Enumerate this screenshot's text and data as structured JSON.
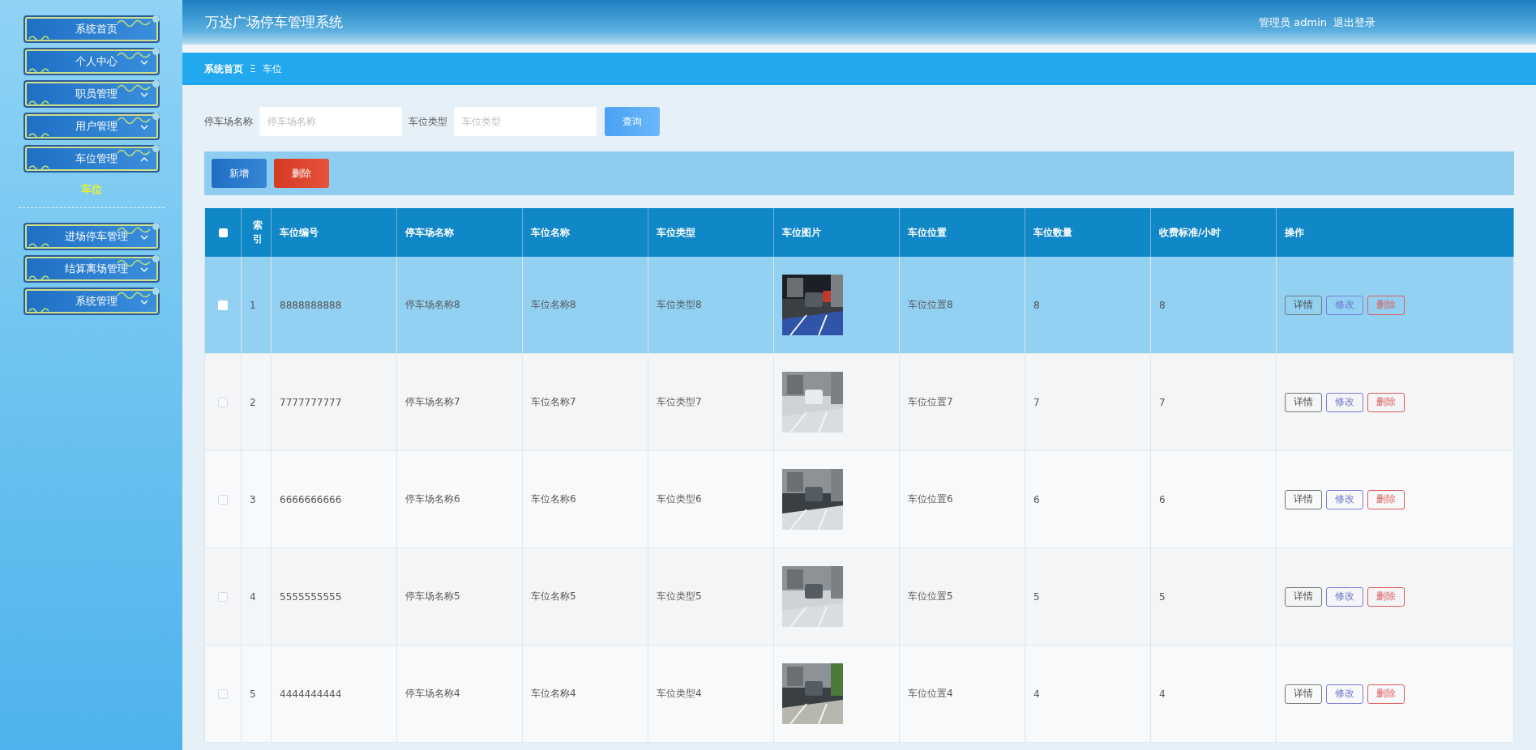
{
  "sidebar": {
    "items": [
      {
        "label": "系统首页",
        "kind": "link"
      },
      {
        "label": "个人中心",
        "kind": "group",
        "expanded": false
      },
      {
        "label": "职员管理",
        "kind": "group",
        "expanded": false
      },
      {
        "label": "用户管理",
        "kind": "group",
        "expanded": false
      },
      {
        "label": "车位管理",
        "kind": "group",
        "expanded": true,
        "children": [
          {
            "label": "车位",
            "selected": true
          }
        ]
      },
      {
        "label": "进场停车管理",
        "kind": "group",
        "expanded": false
      },
      {
        "label": "结算离场管理",
        "kind": "group",
        "expanded": false
      },
      {
        "label": "系统管理",
        "kind": "group",
        "expanded": false
      }
    ]
  },
  "header": {
    "title": "万达广场停车管理系统",
    "user": "管理员 admin",
    "logout": "退出登录"
  },
  "breadcrumb": {
    "items": [
      "系统首页",
      "车位"
    ],
    "separator": "Ξ"
  },
  "search": {
    "fields": [
      {
        "label": "停车场名称",
        "placeholder": "停车场名称"
      },
      {
        "label": "车位类型",
        "placeholder": "车位类型"
      }
    ],
    "button": "查询"
  },
  "toolbar": {
    "buttons": [
      {
        "label": "新增",
        "kind": "add"
      },
      {
        "label": "删除",
        "kind": "delete"
      }
    ]
  },
  "table": {
    "select_all": {
      "checked": false
    },
    "columns": [
      "索引",
      "车位编号",
      "停车场名称",
      "车位名称",
      "车位类型",
      "车位图片",
      "车位位置",
      "车位数量",
      "收费标准/小时",
      "操作"
    ],
    "rows": [
      {
        "index": "1",
        "code": "8888888888",
        "lot": "停车场名称8",
        "name": "车位名称8",
        "type": "车位类型8",
        "position": "车位位置8",
        "count": "8",
        "fee": "8",
        "selected": true,
        "checked": false,
        "actions": [
          {
            "label": "详情",
            "kind": "detail"
          },
          {
            "label": "修改",
            "kind": "edit"
          },
          {
            "label": "删除",
            "kind": "delete"
          }
        ]
      },
      {
        "index": "2",
        "code": "7777777777",
        "lot": "停车场名称7",
        "name": "车位名称7",
        "type": "车位类型7",
        "position": "车位位置7",
        "count": "7",
        "fee": "7",
        "selected": false,
        "checked": false,
        "actions": [
          {
            "label": "详情",
            "kind": "detail"
          },
          {
            "label": "修改",
            "kind": "edit"
          },
          {
            "label": "删除",
            "kind": "delete"
          }
        ]
      },
      {
        "index": "3",
        "code": "6666666666",
        "lot": "停车场名称6",
        "name": "车位名称6",
        "type": "车位类型6",
        "position": "车位位置6",
        "count": "6",
        "fee": "6",
        "selected": false,
        "checked": false,
        "actions": [
          {
            "label": "详情",
            "kind": "detail"
          },
          {
            "label": "修改",
            "kind": "edit"
          },
          {
            "label": "删除",
            "kind": "delete"
          }
        ]
      },
      {
        "index": "4",
        "code": "5555555555",
        "lot": "停车场名称5",
        "name": "车位名称5",
        "type": "车位类型5",
        "position": "车位位置5",
        "count": "5",
        "fee": "5",
        "selected": false,
        "checked": false,
        "actions": [
          {
            "label": "详情",
            "kind": "detail"
          },
          {
            "label": "修改",
            "kind": "edit"
          },
          {
            "label": "删除",
            "kind": "delete"
          }
        ]
      },
      {
        "index": "5",
        "code": "4444444444",
        "lot": "停车场名称4",
        "name": "车位名称4",
        "type": "车位类型4",
        "position": "车位位置4",
        "count": "4",
        "fee": "4",
        "selected": false,
        "checked": false,
        "actions": [
          {
            "label": "详情",
            "kind": "detail"
          },
          {
            "label": "修改",
            "kind": "edit"
          },
          {
            "label": "删除",
            "kind": "delete"
          }
        ]
      }
    ]
  }
}
